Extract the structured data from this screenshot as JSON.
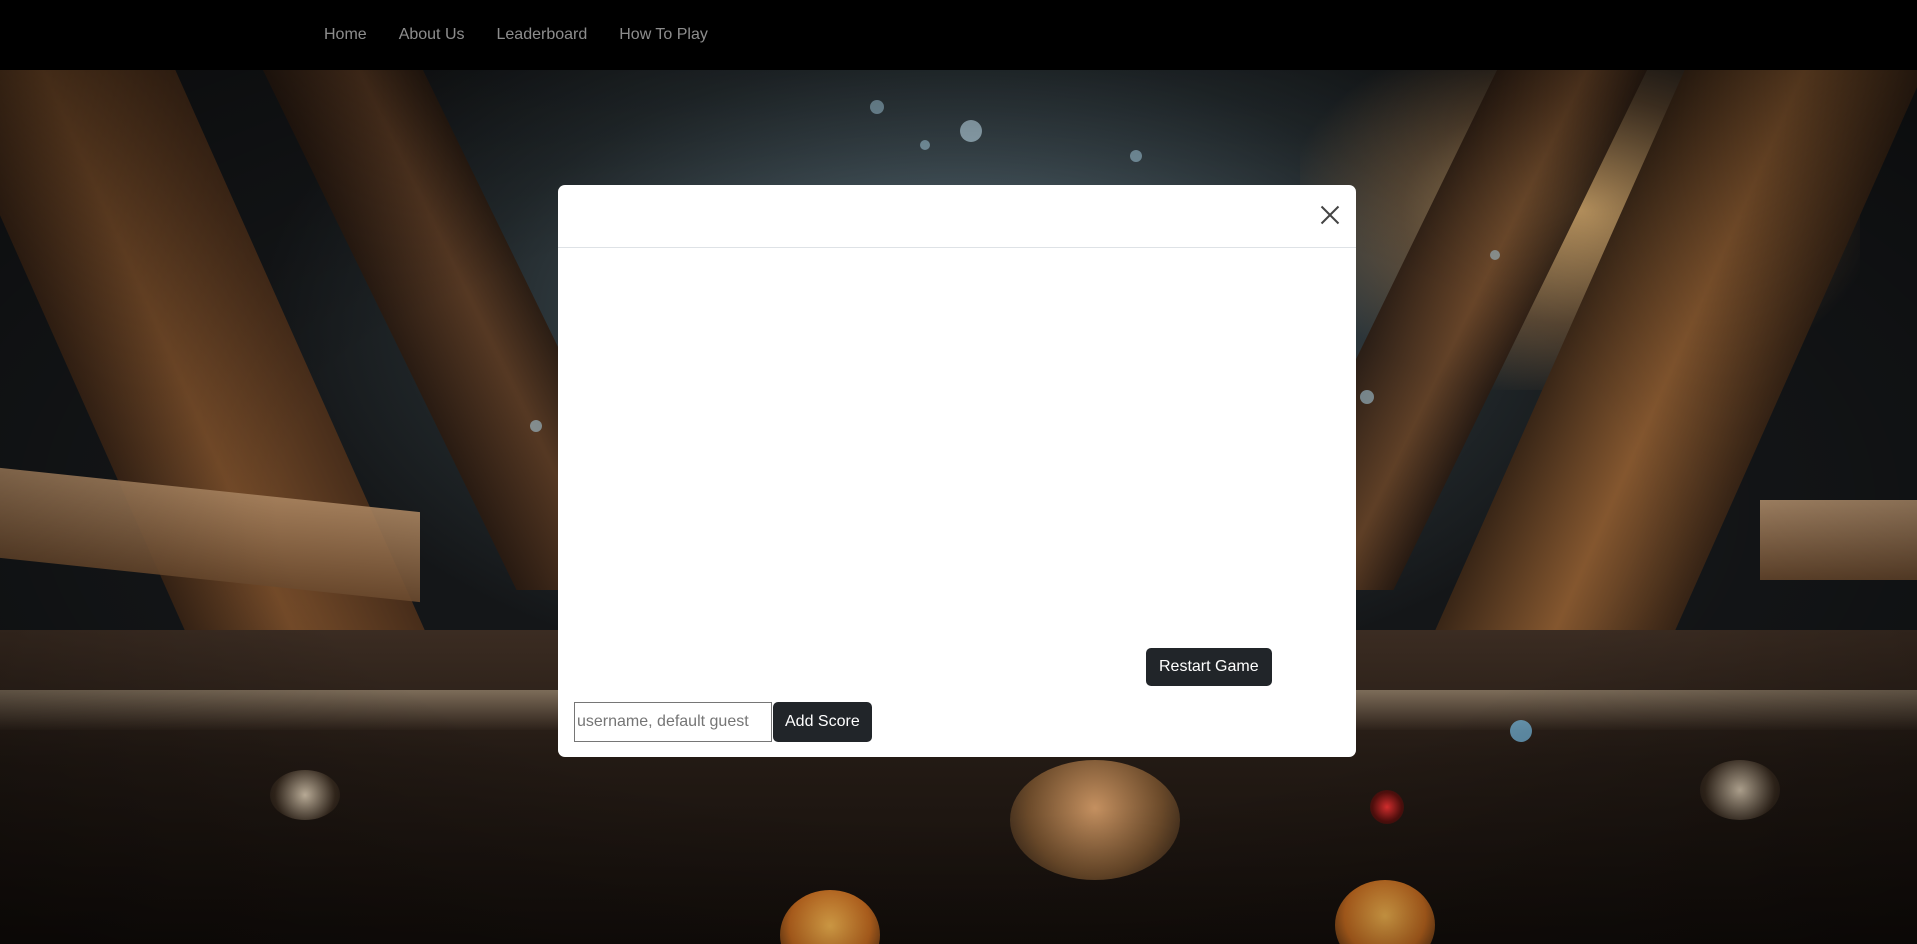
{
  "navbar": {
    "links": [
      {
        "label": "Home"
      },
      {
        "label": "About Us"
      },
      {
        "label": "Leaderboard"
      },
      {
        "label": "How To Play"
      }
    ]
  },
  "modal": {
    "restart_label": "Restart Game",
    "username_placeholder": "username, default guest",
    "username_value": "",
    "add_score_label": "Add Score"
  },
  "background": {
    "icon": "cockpit-scene-image"
  }
}
